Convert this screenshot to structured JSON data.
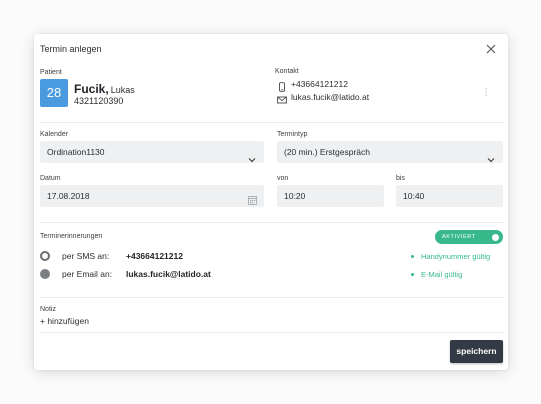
{
  "dialog": {
    "title": "Termin anlegen"
  },
  "patient": {
    "label": "Patient",
    "badge": "28",
    "last_name": "Fucik,",
    "first_name": "Lukas",
    "id_number": "4321120390"
  },
  "contact": {
    "label": "Kontakt",
    "phone": "+43664121212",
    "email": "lukas.fucik@latido.at"
  },
  "calendar": {
    "label": "Kalender",
    "value": "Ordination1130"
  },
  "appointment_type": {
    "label": "Termintyp",
    "value": "(20 min.) Erstgespräch"
  },
  "date": {
    "label": "Datum",
    "value": "17.08.2018"
  },
  "from": {
    "label": "von",
    "value": "10:20"
  },
  "to": {
    "label": "bis",
    "value": "10:40"
  },
  "reminders": {
    "label": "Terminerinnerungen",
    "toggle_label": "AKTIVIERT",
    "toggle_on": true,
    "sms": {
      "label": "per SMS an:",
      "value": "+43664121212",
      "valid": "Handynummer gültig",
      "selected": true
    },
    "email": {
      "label": "per Email an:",
      "value": "lukas.fucik@latido.at",
      "valid": "E-Mail gültig",
      "selected": false
    }
  },
  "note": {
    "label": "Notiz",
    "add": "+ hinzufügen"
  },
  "footer": {
    "save_label": "speichern"
  },
  "colors": {
    "accent_green": "#37b98c",
    "badge_blue": "#4a9ae0",
    "button_dark": "#323a45"
  }
}
